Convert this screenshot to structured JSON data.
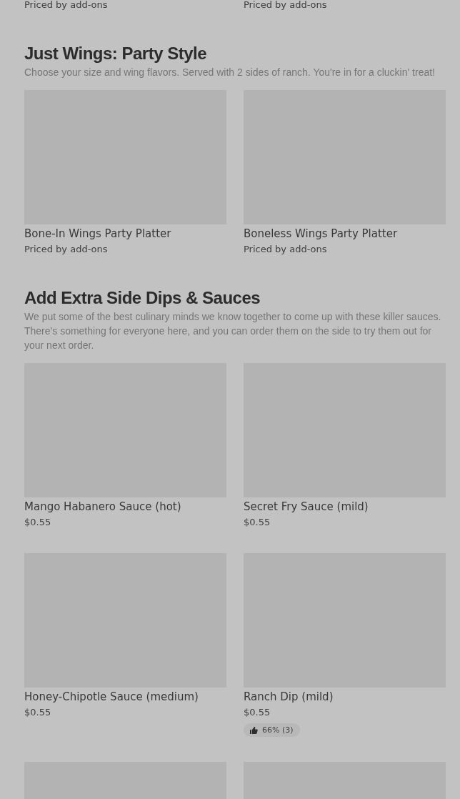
{
  "top_items": [
    {
      "price": "Priced by add-ons"
    },
    {
      "price": "Priced by add-ons"
    }
  ],
  "sections": [
    {
      "title": "Just Wings: Party Style",
      "description": "Choose your size and wing flavors. Served with 2 sides of ranch. You're in for a cluckin' treat!",
      "items": [
        {
          "kind": "product",
          "name": "Bone-In Wings Party Platter",
          "price": "Priced by add-ons"
        },
        {
          "kind": "product",
          "name": "Boneless Wings Party Platter",
          "price": "Priced by add-ons"
        }
      ]
    },
    {
      "title": "Add Extra Side Dips & Sauces",
      "description": "We put some of the best culinary minds we know together to come up with these killer sauces. There's something for everyone here, and you can order them on the side to try them out for your next order.",
      "items": [
        {
          "kind": "product",
          "name": "Mango Habanero Sauce (hot)",
          "price": "$0.55"
        },
        {
          "kind": "product",
          "name": "Secret Fry Sauce (mild)",
          "price": "$0.55"
        },
        {
          "kind": "product",
          "name": "Honey-Chipotle Sauce (medium)",
          "price": "$0.55"
        },
        {
          "kind": "product",
          "name": "Ranch Dip (mild)",
          "price": "$0.55",
          "rating": "66% (3)"
        },
        {
          "kind": "picture"
        },
        {
          "kind": "picture"
        }
      ]
    }
  ]
}
